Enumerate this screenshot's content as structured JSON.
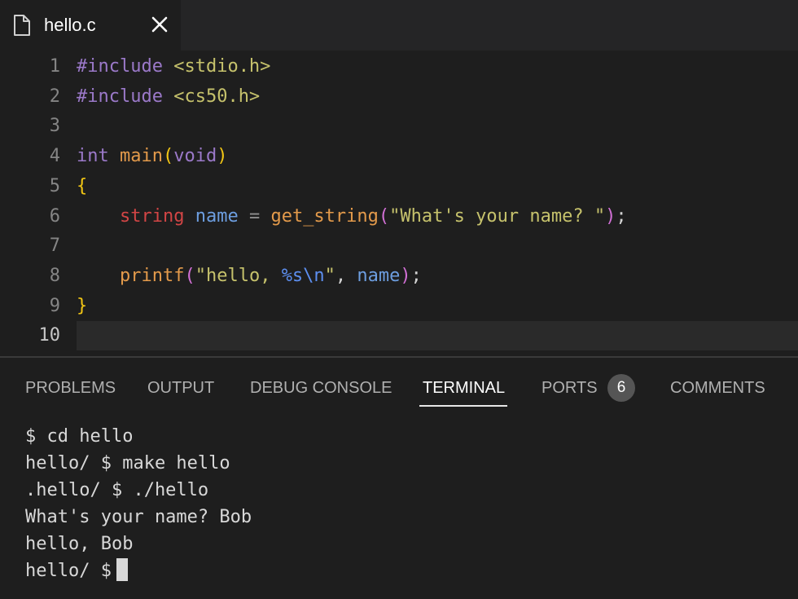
{
  "tab": {
    "label": "hello.c",
    "file_icon": "file-icon",
    "close_icon": "close-icon"
  },
  "editor": {
    "line_numbers": [
      "1",
      "2",
      "3",
      "4",
      "5",
      "6",
      "7",
      "8",
      "9",
      "10"
    ],
    "lines": [
      [
        {
          "t": "#include",
          "c": "t-kw"
        },
        {
          "t": " ",
          "c": "t-plain"
        },
        {
          "t": "<stdio.h>",
          "c": "t-str"
        }
      ],
      [
        {
          "t": "#include",
          "c": "t-kw"
        },
        {
          "t": " ",
          "c": "t-plain"
        },
        {
          "t": "<cs50.h>",
          "c": "t-str"
        }
      ],
      [],
      [
        {
          "t": "int",
          "c": "t-type"
        },
        {
          "t": " ",
          "c": "t-plain"
        },
        {
          "t": "main",
          "c": "t-fn"
        },
        {
          "t": "(",
          "c": "t-paren"
        },
        {
          "t": "void",
          "c": "t-type"
        },
        {
          "t": ")",
          "c": "t-paren"
        }
      ],
      [
        {
          "t": "{",
          "c": "t-brace"
        }
      ],
      [
        {
          "t": "    ",
          "c": "t-plain"
        },
        {
          "t": "string",
          "c": "t-red"
        },
        {
          "t": " ",
          "c": "t-plain"
        },
        {
          "t": "name",
          "c": "t-var"
        },
        {
          "t": " ",
          "c": "t-plain"
        },
        {
          "t": "=",
          "c": "t-op"
        },
        {
          "t": " ",
          "c": "t-plain"
        },
        {
          "t": "get_string",
          "c": "t-fn"
        },
        {
          "t": "(",
          "c": "t-paren2"
        },
        {
          "t": "\"What's your name? \"",
          "c": "t-str"
        },
        {
          "t": ")",
          "c": "t-paren2"
        },
        {
          "t": ";",
          "c": "t-plain"
        }
      ],
      [],
      [
        {
          "t": "    ",
          "c": "t-plain"
        },
        {
          "t": "printf",
          "c": "t-fn"
        },
        {
          "t": "(",
          "c": "t-paren2"
        },
        {
          "t": "\"hello, ",
          "c": "t-str"
        },
        {
          "t": "%s\\n",
          "c": "t-fmt"
        },
        {
          "t": "\"",
          "c": "t-str"
        },
        {
          "t": ", ",
          "c": "t-plain"
        },
        {
          "t": "name",
          "c": "t-var"
        },
        {
          "t": ")",
          "c": "t-paren2"
        },
        {
          "t": ";",
          "c": "t-plain"
        }
      ],
      [
        {
          "t": "}",
          "c": "t-brace"
        }
      ],
      []
    ]
  },
  "panel": {
    "tabs": {
      "problems": "PROBLEMS",
      "output": "OUTPUT",
      "debug_console": "DEBUG CONSOLE",
      "terminal": "TERMINAL",
      "ports": "PORTS",
      "comments": "COMMENTS"
    },
    "ports_badge": "6",
    "active_tab": "TERMINAL"
  },
  "terminal": {
    "lines": [
      "$ cd hello",
      "hello/ $ make hello",
      ".hello/ $ ./hello",
      "What's your name? Bob",
      "hello, Bob",
      "hello/ $"
    ]
  }
}
